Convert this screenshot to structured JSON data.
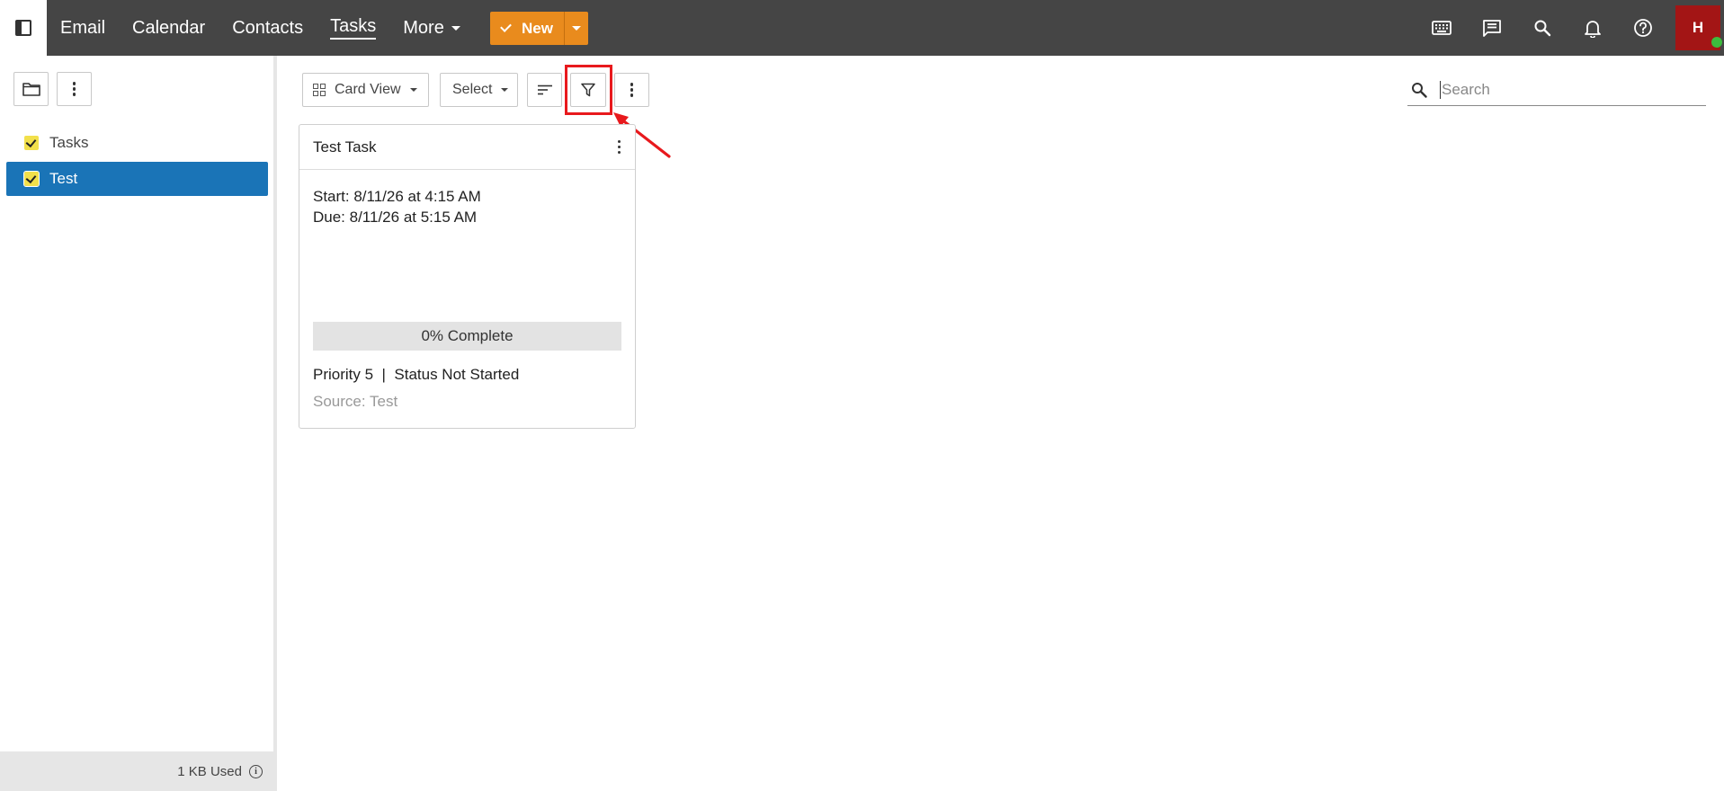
{
  "topbar": {
    "nav": [
      {
        "label": "Email",
        "active": false
      },
      {
        "label": "Calendar",
        "active": false
      },
      {
        "label": "Contacts",
        "active": false
      },
      {
        "label": "Tasks",
        "active": true
      },
      {
        "label": "More",
        "active": false
      }
    ],
    "new_label": "New",
    "avatar_initial": "H",
    "icons": [
      "keyboard-icon",
      "chat-icon",
      "search-icon",
      "bell-icon",
      "help-icon"
    ],
    "colors": {
      "bar": "#454545",
      "new": "#e98b1d",
      "avatar": "#a31515",
      "presence": "#3dbb3d"
    }
  },
  "sidebar": {
    "folders": [
      {
        "label": "Tasks",
        "selected": false
      },
      {
        "label": "Test",
        "selected": true
      }
    ],
    "storage_label": "1 KB Used",
    "colors": {
      "selected": "#1a74b7",
      "checkbox": "#f2e04b"
    }
  },
  "toolbar": {
    "view_label": "Card View",
    "select_label": "Select",
    "search_placeholder": "Search"
  },
  "card": {
    "title": "Test Task",
    "start": "Start: 8/11/26 at 4:15 AM",
    "due": "Due: 8/11/26 at 5:15 AM",
    "progress_label": "0% Complete",
    "progress_value": 0,
    "meta": "Priority 5  |  Status Not Started",
    "source": "Source: Test"
  },
  "annotation": {
    "color": "#e8191d"
  }
}
